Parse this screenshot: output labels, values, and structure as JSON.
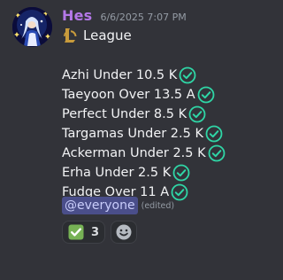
{
  "message": {
    "author": "Hes",
    "timestamp": "6/6/2025 7:07 PM",
    "league_label": "League",
    "bets": [
      "Azhi Under 10.5 K",
      "Taeyoon Over 13.5 A",
      "Perfect Under 8.5 K",
      "Targamas Under 2.5 K",
      "Ackerman Under 2.5 K",
      "Erha Under 2.5 K",
      "Fudge Over 11 A"
    ],
    "mention": "@everyone",
    "edited": "(edited)"
  },
  "reactions": [
    {
      "emoji": "white-check-mark",
      "count": "3"
    }
  ],
  "icons": {
    "check": "check-circle-icon",
    "league": "league-of-legends-icon",
    "add_reaction": "add-reaction-smiley-icon"
  },
  "colors": {
    "background": "#323339",
    "username": "#b478e8",
    "check": "#2fd6a6",
    "mention_bg": "#4a4e8a",
    "league_gold": "#c89b3c"
  }
}
